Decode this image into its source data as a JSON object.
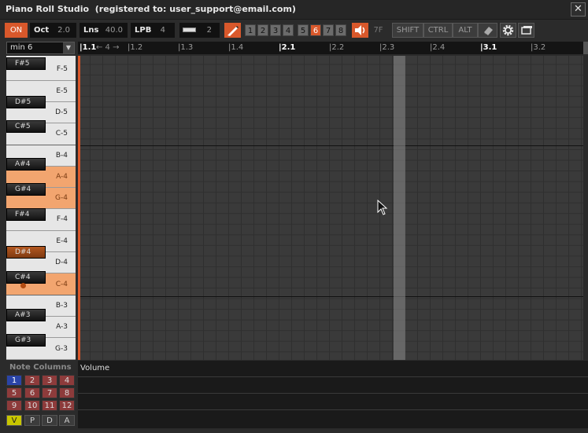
{
  "window": {
    "title": "Piano Roll Studio  (registered to: user_support@email.com)",
    "close_icon": "close-icon"
  },
  "toolbar": {
    "on_label": "ON",
    "oct_label": "Oct",
    "oct_value": "2.0",
    "lns_label": "Lns",
    "lns_value": "40.0",
    "lpb_label": "LPB",
    "lpb_value": "4",
    "steps_value": "2",
    "numbers": [
      "1",
      "2",
      "3",
      "4",
      "5",
      "6",
      "7",
      "8"
    ],
    "active_number": "6",
    "velocity_value": "7F",
    "shift_label": "SHIFT",
    "ctrl_label": "CTRL",
    "alt_label": "ALT",
    "accent_color": "#d9582b"
  },
  "scale": {
    "selected": "min 6"
  },
  "ruler": {
    "marks": [
      "1.1",
      "1.2",
      "1.3",
      "1.4",
      "2.1",
      "2.2",
      "2.3",
      "2.4",
      "3.1",
      "3.2"
    ],
    "loop_marker": "← 4 →"
  },
  "keyboard": {
    "white_keys": [
      "F-5",
      "E-5",
      "D-5",
      "C-5",
      "B-4",
      "A-4",
      "G-4",
      "F-4",
      "E-4",
      "D-4",
      "C-4",
      "B-3",
      "A-3",
      "G-3"
    ],
    "black_keys": [
      "F#5",
      "D#5",
      "C#5",
      "A#4",
      "G#4",
      "F#4",
      "D#4",
      "C#4",
      "A#3",
      "G#3"
    ],
    "highlighted_keys": [
      "A-4",
      "G-4",
      "C-4"
    ],
    "active_black_key": "D#4"
  },
  "note_columns": {
    "title": "Note Columns",
    "columns": [
      "1",
      "2",
      "3",
      "4",
      "5",
      "6",
      "7",
      "8",
      "9",
      "10",
      "11",
      "12"
    ],
    "active_column": "1",
    "toggles": [
      "V",
      "P",
      "D",
      "A"
    ],
    "active_toggle": "V"
  },
  "lane": {
    "title": "Volume"
  }
}
